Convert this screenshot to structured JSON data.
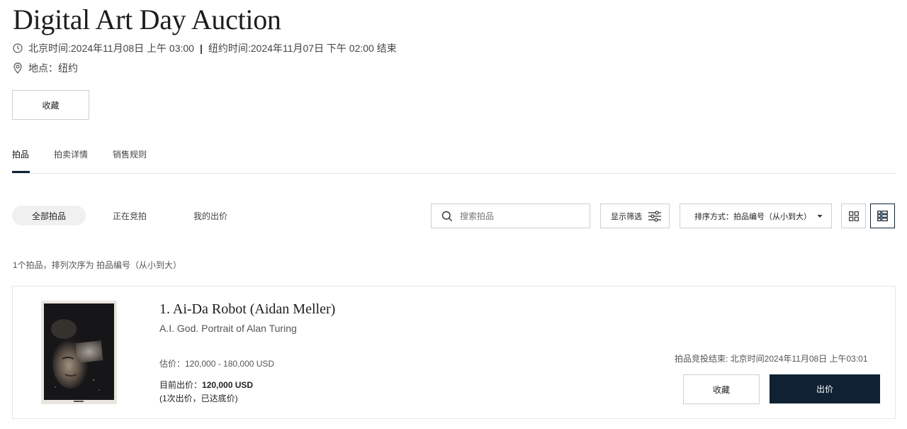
{
  "header": {
    "title": "Digital Art Day Auction",
    "time_beijing": "北京时间:2024年11月08日 上午 03:00",
    "separator": "|",
    "time_newyork": "纽约时间:2024年11月07日 下午 02:00 结束",
    "location": "地点：纽约",
    "favorite_label": "收藏"
  },
  "tabs": [
    {
      "label": "拍品",
      "active": true
    },
    {
      "label": "拍卖详情",
      "active": false
    },
    {
      "label": "销售规则",
      "active": false
    }
  ],
  "filters": {
    "pills": [
      {
        "label": "全部拍品",
        "active": true
      },
      {
        "label": "正在竞拍",
        "active": false
      },
      {
        "label": "我的出价",
        "active": false
      }
    ],
    "search_placeholder": "搜索拍品",
    "filter_label": "显示筛选",
    "sort_label": "排序方式：拍品编号（从小到大）",
    "view_modes": [
      "grid-view-icon",
      "list-view-icon"
    ],
    "active_view": "list"
  },
  "results_summary": "1个拍品，排列次序为 拍品编号（从小到大）",
  "lot": {
    "title": "1. Ai-Da Robot (Aidan Meller)",
    "subtitle": "A.I. God. Portrait of Alan Turing",
    "estimate": "估价：120,000 - 180,000 USD",
    "current_bid_label": "目前出价：",
    "current_bid_value": "120,000 USD",
    "bid_info": "(1次出价，已达底价)",
    "closing": "拍品竞投结束: 北京时间2024年11月08日 上午03:01",
    "favorite_label": "收藏",
    "bid_label": "出价"
  },
  "colors": {
    "primary_navy": "#0f2233",
    "border": "#cfcfcf",
    "pill_bg": "#f0f0f0"
  }
}
